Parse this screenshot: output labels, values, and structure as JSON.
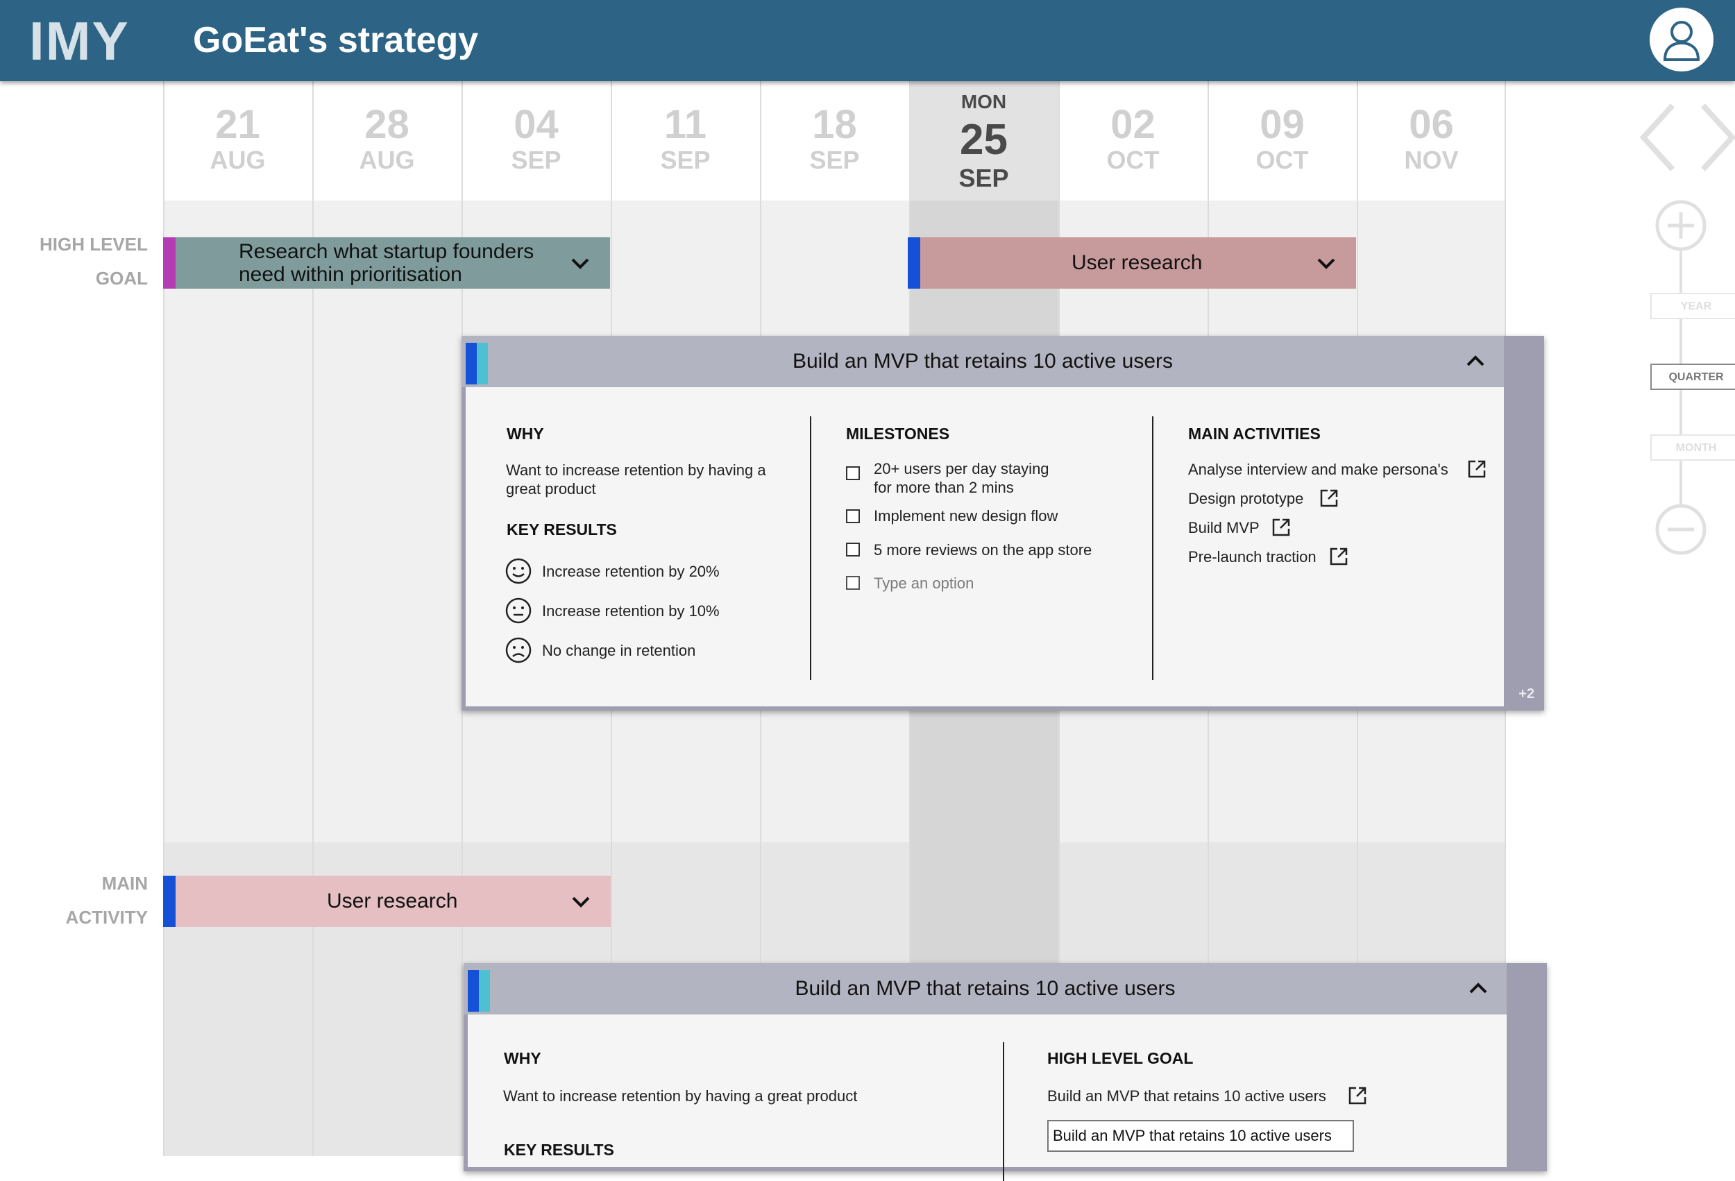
{
  "header": {
    "logo": "IMY",
    "title": "GoEat's strategy"
  },
  "dates": [
    {
      "day": "21",
      "month": "AUG"
    },
    {
      "day": "28",
      "month": "AUG"
    },
    {
      "day": "04",
      "month": "SEP"
    },
    {
      "day": "11",
      "month": "SEP"
    },
    {
      "day": "18",
      "month": "SEP"
    },
    {
      "weekday": "MON",
      "day": "25",
      "month": "SEP",
      "current": true
    },
    {
      "day": "02",
      "month": "OCT"
    },
    {
      "day": "09",
      "month": "OCT"
    },
    {
      "day": "06",
      "month": "NOV"
    }
  ],
  "rows": {
    "high_level_goal": {
      "line1": "HIGH LEVEL",
      "line2": "GOAL"
    },
    "main_activity": {
      "line1": "MAIN",
      "line2": "ACTIVITY"
    }
  },
  "bars": {
    "hlg_research": {
      "line1": "Research what startup founders",
      "line2": "need within prioritisation",
      "color": "#7f9b9b",
      "accent": "#b43cb4"
    },
    "hlg_user_research": {
      "label": "User research",
      "color": "#c79a9c",
      "accent": "#1551d6"
    },
    "ma_user_research": {
      "label": "User research",
      "color": "#e5bfc1",
      "accent": "#1551d6"
    }
  },
  "card1": {
    "title": "Build an MVP that retains 10 active users",
    "why_heading": "WHY",
    "why_line1": "Want to increase retention by having a",
    "why_line2": "great product",
    "kr_heading": "KEY RESULTS",
    "key_results": [
      "Increase retention by 20%",
      "Increase retention by 10%",
      "No change in retention"
    ],
    "milestones_heading": "MILESTONES",
    "milestone1_line1": "20+ users per day staying",
    "milestone1_line2": "for more than 2 mins",
    "milestone2": "Implement new design flow",
    "milestone3": "5 more reviews on the app store",
    "milestone_placeholder": "Type an option",
    "activities_heading": "MAIN ACTIVITIES",
    "activities": [
      "Analyse interview and make persona's",
      "Design prototype",
      "Build MVP",
      "Pre-launch traction"
    ],
    "overflow": "+2"
  },
  "card2": {
    "title": "Build an MVP that retains 10 active users",
    "why_heading": "WHY",
    "why_text": "Want to increase retention by having a great product",
    "kr_heading": "KEY RESULTS",
    "hlg_heading": "HIGH LEVEL GOAL",
    "hlg_link": "Build an MVP that retains 10 active users",
    "hlg_option": "Build an MVP that retains 10 active users"
  },
  "zoom": {
    "year": "YEAR",
    "quarter": "QUARTER",
    "month": "MONTH"
  }
}
